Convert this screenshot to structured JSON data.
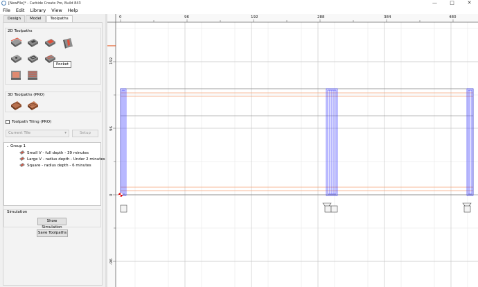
{
  "window": {
    "title": "[NewFile]* - Carbide Create Pro, Build 843",
    "controls": [
      "—",
      "□",
      "✕"
    ]
  },
  "menu": [
    "File",
    "Edit",
    "Library",
    "View",
    "Help"
  ],
  "tabs": [
    {
      "label": "Design",
      "active": false
    },
    {
      "label": "Model",
      "active": false
    },
    {
      "label": "Toolpaths",
      "active": true
    }
  ],
  "toolpaths_2d": {
    "title": "2D Toolpaths",
    "tools": [
      "contour-toolpath-icon",
      "pocket-toolpath-icon",
      "pocket-toolpath-icon-hover",
      "vcarve-toolpath-icon",
      "drill-toolpath-icon",
      "advanced-vcarve-icon",
      "texture-toolpath-icon",
      "engrave-toolpath-icon",
      "facing-toolpath-icon"
    ],
    "tooltip": "Pocket"
  },
  "toolpaths_3d": {
    "title": "3D Toolpaths (PRO)",
    "tools": [
      "rough-3d-icon",
      "finish-3d-icon"
    ]
  },
  "tiling": {
    "label": "Toolpath Tiling (PRO)",
    "checked": false,
    "tile_select": "Current Tile",
    "setup_label": "Setup"
  },
  "tree": {
    "group": "Group 1",
    "items": [
      {
        "label": "Small V - full depth - 39 minutes"
      },
      {
        "label": "Large V - radius depth - Under 2 minutes"
      },
      {
        "label": "Square - radius depth - 6 minutes"
      }
    ]
  },
  "simulation": {
    "label": "Simulation",
    "show_label": "Show Simulation"
  },
  "save_toolpaths_label": "Save Toolpaths",
  "viewport": {
    "ruler_top": [
      "0",
      "96",
      "192",
      "288",
      "384",
      "480"
    ],
    "ruler_left": [
      "192",
      "96",
      "0",
      "-96"
    ],
    "colors": {
      "toolpath_orange": "#f4a276",
      "toolpath_blue": "#3333ff",
      "origin_red": "#e00000",
      "grid": "#dcdcdc"
    }
  }
}
